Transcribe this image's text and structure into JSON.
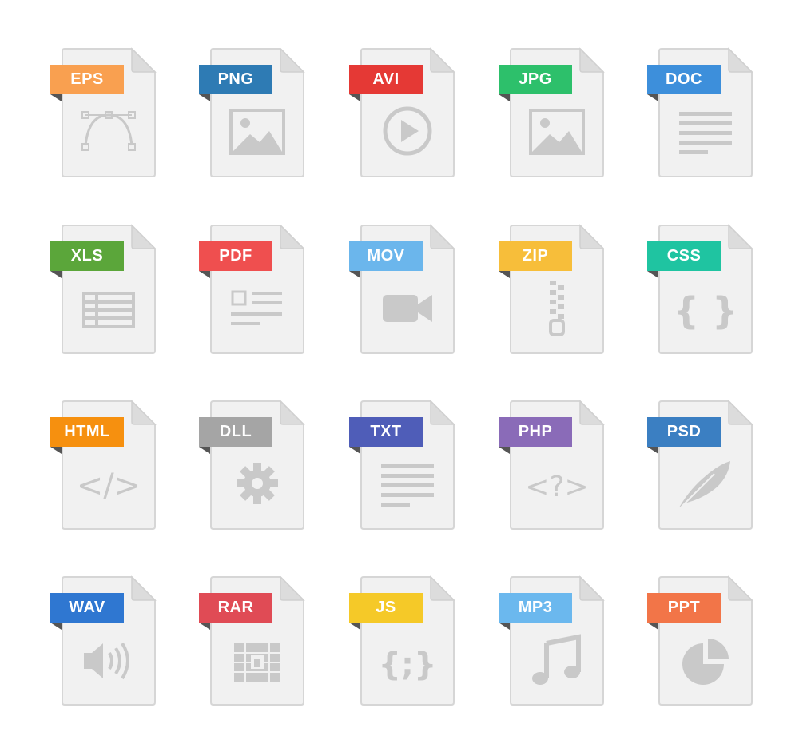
{
  "files": [
    {
      "label": "EPS",
      "color": "#F9A050",
      "icon": "bezier-curve-icon"
    },
    {
      "label": "PNG",
      "color": "#2E7BB4",
      "icon": "image-icon"
    },
    {
      "label": "AVI",
      "color": "#E53935",
      "icon": "play-circle-icon"
    },
    {
      "label": "JPG",
      "color": "#2DC06B",
      "icon": "image-icon"
    },
    {
      "label": "DOC",
      "color": "#3D8FDB",
      "icon": "text-lines-icon"
    },
    {
      "label": "XLS",
      "color": "#5BA63A",
      "icon": "spreadsheet-icon"
    },
    {
      "label": "PDF",
      "color": "#EF4F4F",
      "icon": "document-layout-icon"
    },
    {
      "label": "MOV",
      "color": "#6BB6EC",
      "icon": "video-camera-icon"
    },
    {
      "label": "ZIP",
      "color": "#F7BE3A",
      "icon": "zipper-icon"
    },
    {
      "label": "CSS",
      "color": "#1FC4A1",
      "icon": "curly-braces-icon"
    },
    {
      "label": "HTML",
      "color": "#F6900F",
      "icon": "code-tag-icon"
    },
    {
      "label": "DLL",
      "color": "#A5A5A5",
      "icon": "gear-icon"
    },
    {
      "label": "TXT",
      "color": "#4F5DB8",
      "icon": "text-lines-icon"
    },
    {
      "label": "PHP",
      "color": "#8A6BB8",
      "icon": "php-tag-icon"
    },
    {
      "label": "PSD",
      "color": "#3B7FC2",
      "icon": "feather-icon"
    },
    {
      "label": "WAV",
      "color": "#2F77D1",
      "icon": "speaker-icon"
    },
    {
      "label": "RAR",
      "color": "#E04B55",
      "icon": "archive-icon"
    },
    {
      "label": "JS",
      "color": "#F5C928",
      "icon": "js-braces-icon"
    },
    {
      "label": "MP3",
      "color": "#6BB8EE",
      "icon": "music-note-icon"
    },
    {
      "label": "PPT",
      "color": "#F27548",
      "icon": "pie-chart-icon"
    }
  ]
}
